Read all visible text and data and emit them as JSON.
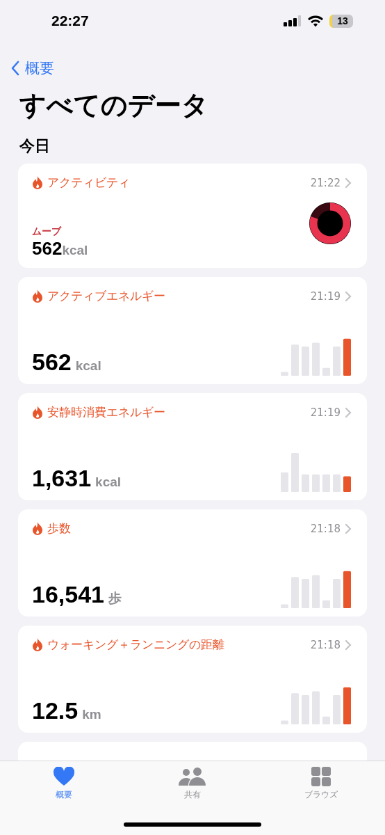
{
  "status_bar": {
    "time": "22:27",
    "battery": "13"
  },
  "nav": {
    "back": "概要"
  },
  "title": "すべてのデータ",
  "section": "今日",
  "cards": [
    {
      "kind": "ring",
      "title": "アクティビティ",
      "time": "21:22",
      "label": "ムーブ",
      "value": "562",
      "unit": "kcal"
    },
    {
      "kind": "bars",
      "title": "アクティブエネルギー",
      "time": "21:19",
      "value": "562",
      "unit": "kcal"
    },
    {
      "kind": "bars",
      "title": "安静時消費エネルギー",
      "time": "21:19",
      "value": "1,631",
      "unit": "kcal"
    },
    {
      "kind": "bars",
      "title": "歩数",
      "time": "21:18",
      "value": "16,541",
      "unit": "歩"
    },
    {
      "kind": "bars",
      "title": "ウォーキング＋ランニングの距離",
      "time": "21:18",
      "value": "12.5",
      "unit": "km"
    }
  ],
  "tabs": [
    {
      "kind": "heart",
      "label": "概要",
      "selected": true
    },
    {
      "kind": "people",
      "label": "共有",
      "selected": false
    },
    {
      "kind": "grid",
      "label": "ブラウズ",
      "selected": false
    }
  ]
}
